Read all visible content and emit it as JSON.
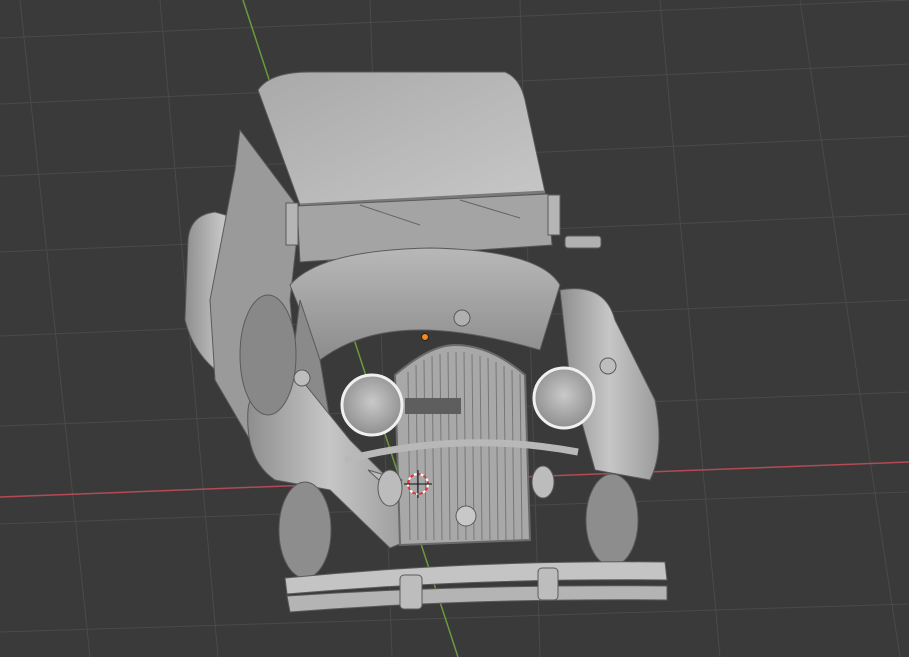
{
  "viewport": {
    "background": "#3a3a3a",
    "grid_color": "#4a4a4a",
    "x_axis_color": "#b34a55",
    "y_axis_color": "#6c9a3b",
    "origin_marker_color": "#f28c1e",
    "cursor_color": "#ffffff",
    "cursor_ring_color": "#d83a3a"
  },
  "model": {
    "name_icon": "vintage-car-mesh",
    "shading": "solid"
  }
}
